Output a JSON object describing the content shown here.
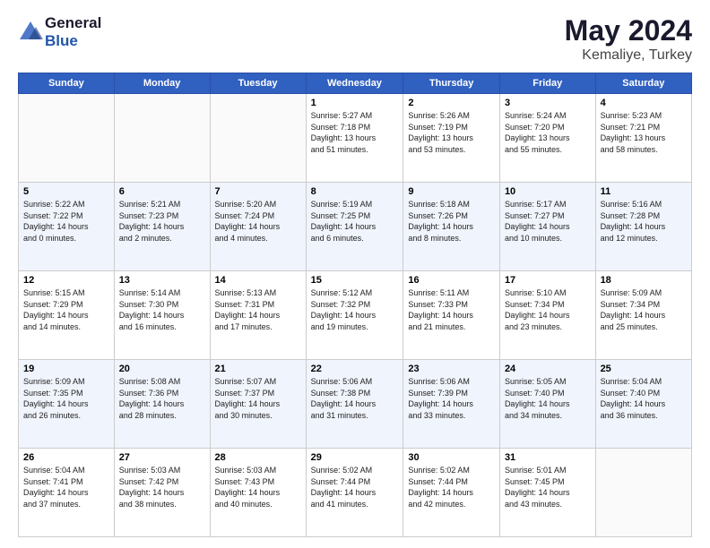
{
  "header": {
    "logo_general": "General",
    "logo_blue": "Blue",
    "month_title": "May 2024",
    "subtitle": "Kemaliye, Turkey"
  },
  "days_of_week": [
    "Sunday",
    "Monday",
    "Tuesday",
    "Wednesday",
    "Thursday",
    "Friday",
    "Saturday"
  ],
  "weeks": [
    [
      {
        "day": "",
        "info": ""
      },
      {
        "day": "",
        "info": ""
      },
      {
        "day": "",
        "info": ""
      },
      {
        "day": "1",
        "info": "Sunrise: 5:27 AM\nSunset: 7:18 PM\nDaylight: 13 hours\nand 51 minutes."
      },
      {
        "day": "2",
        "info": "Sunrise: 5:26 AM\nSunset: 7:19 PM\nDaylight: 13 hours\nand 53 minutes."
      },
      {
        "day": "3",
        "info": "Sunrise: 5:24 AM\nSunset: 7:20 PM\nDaylight: 13 hours\nand 55 minutes."
      },
      {
        "day": "4",
        "info": "Sunrise: 5:23 AM\nSunset: 7:21 PM\nDaylight: 13 hours\nand 58 minutes."
      }
    ],
    [
      {
        "day": "5",
        "info": "Sunrise: 5:22 AM\nSunset: 7:22 PM\nDaylight: 14 hours\nand 0 minutes."
      },
      {
        "day": "6",
        "info": "Sunrise: 5:21 AM\nSunset: 7:23 PM\nDaylight: 14 hours\nand 2 minutes."
      },
      {
        "day": "7",
        "info": "Sunrise: 5:20 AM\nSunset: 7:24 PM\nDaylight: 14 hours\nand 4 minutes."
      },
      {
        "day": "8",
        "info": "Sunrise: 5:19 AM\nSunset: 7:25 PM\nDaylight: 14 hours\nand 6 minutes."
      },
      {
        "day": "9",
        "info": "Sunrise: 5:18 AM\nSunset: 7:26 PM\nDaylight: 14 hours\nand 8 minutes."
      },
      {
        "day": "10",
        "info": "Sunrise: 5:17 AM\nSunset: 7:27 PM\nDaylight: 14 hours\nand 10 minutes."
      },
      {
        "day": "11",
        "info": "Sunrise: 5:16 AM\nSunset: 7:28 PM\nDaylight: 14 hours\nand 12 minutes."
      }
    ],
    [
      {
        "day": "12",
        "info": "Sunrise: 5:15 AM\nSunset: 7:29 PM\nDaylight: 14 hours\nand 14 minutes."
      },
      {
        "day": "13",
        "info": "Sunrise: 5:14 AM\nSunset: 7:30 PM\nDaylight: 14 hours\nand 16 minutes."
      },
      {
        "day": "14",
        "info": "Sunrise: 5:13 AM\nSunset: 7:31 PM\nDaylight: 14 hours\nand 17 minutes."
      },
      {
        "day": "15",
        "info": "Sunrise: 5:12 AM\nSunset: 7:32 PM\nDaylight: 14 hours\nand 19 minutes."
      },
      {
        "day": "16",
        "info": "Sunrise: 5:11 AM\nSunset: 7:33 PM\nDaylight: 14 hours\nand 21 minutes."
      },
      {
        "day": "17",
        "info": "Sunrise: 5:10 AM\nSunset: 7:34 PM\nDaylight: 14 hours\nand 23 minutes."
      },
      {
        "day": "18",
        "info": "Sunrise: 5:09 AM\nSunset: 7:34 PM\nDaylight: 14 hours\nand 25 minutes."
      }
    ],
    [
      {
        "day": "19",
        "info": "Sunrise: 5:09 AM\nSunset: 7:35 PM\nDaylight: 14 hours\nand 26 minutes."
      },
      {
        "day": "20",
        "info": "Sunrise: 5:08 AM\nSunset: 7:36 PM\nDaylight: 14 hours\nand 28 minutes."
      },
      {
        "day": "21",
        "info": "Sunrise: 5:07 AM\nSunset: 7:37 PM\nDaylight: 14 hours\nand 30 minutes."
      },
      {
        "day": "22",
        "info": "Sunrise: 5:06 AM\nSunset: 7:38 PM\nDaylight: 14 hours\nand 31 minutes."
      },
      {
        "day": "23",
        "info": "Sunrise: 5:06 AM\nSunset: 7:39 PM\nDaylight: 14 hours\nand 33 minutes."
      },
      {
        "day": "24",
        "info": "Sunrise: 5:05 AM\nSunset: 7:40 PM\nDaylight: 14 hours\nand 34 minutes."
      },
      {
        "day": "25",
        "info": "Sunrise: 5:04 AM\nSunset: 7:40 PM\nDaylight: 14 hours\nand 36 minutes."
      }
    ],
    [
      {
        "day": "26",
        "info": "Sunrise: 5:04 AM\nSunset: 7:41 PM\nDaylight: 14 hours\nand 37 minutes."
      },
      {
        "day": "27",
        "info": "Sunrise: 5:03 AM\nSunset: 7:42 PM\nDaylight: 14 hours\nand 38 minutes."
      },
      {
        "day": "28",
        "info": "Sunrise: 5:03 AM\nSunset: 7:43 PM\nDaylight: 14 hours\nand 40 minutes."
      },
      {
        "day": "29",
        "info": "Sunrise: 5:02 AM\nSunset: 7:44 PM\nDaylight: 14 hours\nand 41 minutes."
      },
      {
        "day": "30",
        "info": "Sunrise: 5:02 AM\nSunset: 7:44 PM\nDaylight: 14 hours\nand 42 minutes."
      },
      {
        "day": "31",
        "info": "Sunrise: 5:01 AM\nSunset: 7:45 PM\nDaylight: 14 hours\nand 43 minutes."
      },
      {
        "day": "",
        "info": ""
      }
    ]
  ]
}
